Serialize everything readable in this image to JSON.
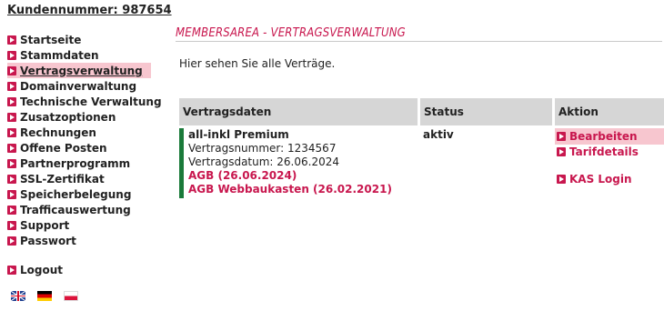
{
  "customer": {
    "label": "Kundennummer: 987654"
  },
  "nav": {
    "items": [
      {
        "label": "Startseite"
      },
      {
        "label": "Stammdaten"
      },
      {
        "label": "Vertragsverwaltung"
      },
      {
        "label": "Domainverwaltung"
      },
      {
        "label": "Technische Verwaltung"
      },
      {
        "label": "Zusatzoptionen"
      },
      {
        "label": "Rechnungen"
      },
      {
        "label": "Offene Posten"
      },
      {
        "label": "Partnerprogramm"
      },
      {
        "label": "SSL-Zertifikat"
      },
      {
        "label": "Speicherbelegung"
      },
      {
        "label": "Trafficauswertung"
      },
      {
        "label": "Support"
      },
      {
        "label": "Passwort"
      }
    ],
    "active": "Vertragsverwaltung",
    "logout": "Logout"
  },
  "languages": [
    "english-flag",
    "german-flag",
    "polish-flag"
  ],
  "main": {
    "heading": "MEMBERSAREA - VERTRAGSVERWALTUNG",
    "intro": "Hier sehen Sie alle Verträge."
  },
  "table": {
    "headers": [
      "Vertragsdaten",
      "Status",
      "Aktion"
    ],
    "contract": {
      "name": "all-inkl Premium",
      "number": "Vertragsnummer: 1234567",
      "date": "Vertragsdatum: 26.06.2024",
      "agb": "AGB (26.06.2024)",
      "agb_web": "AGB Webbaukasten (26.02.2021)"
    },
    "status": "aktiv",
    "actions": {
      "edit": "Bearbeiten",
      "tariff": "Tarifdetails",
      "kas": "KAS Login"
    }
  },
  "colors": {
    "accent": "#c8174e",
    "highlight": "#f7c6cf",
    "header_bg": "#d6d6d6",
    "contract_bar": "#1a7a3a"
  }
}
